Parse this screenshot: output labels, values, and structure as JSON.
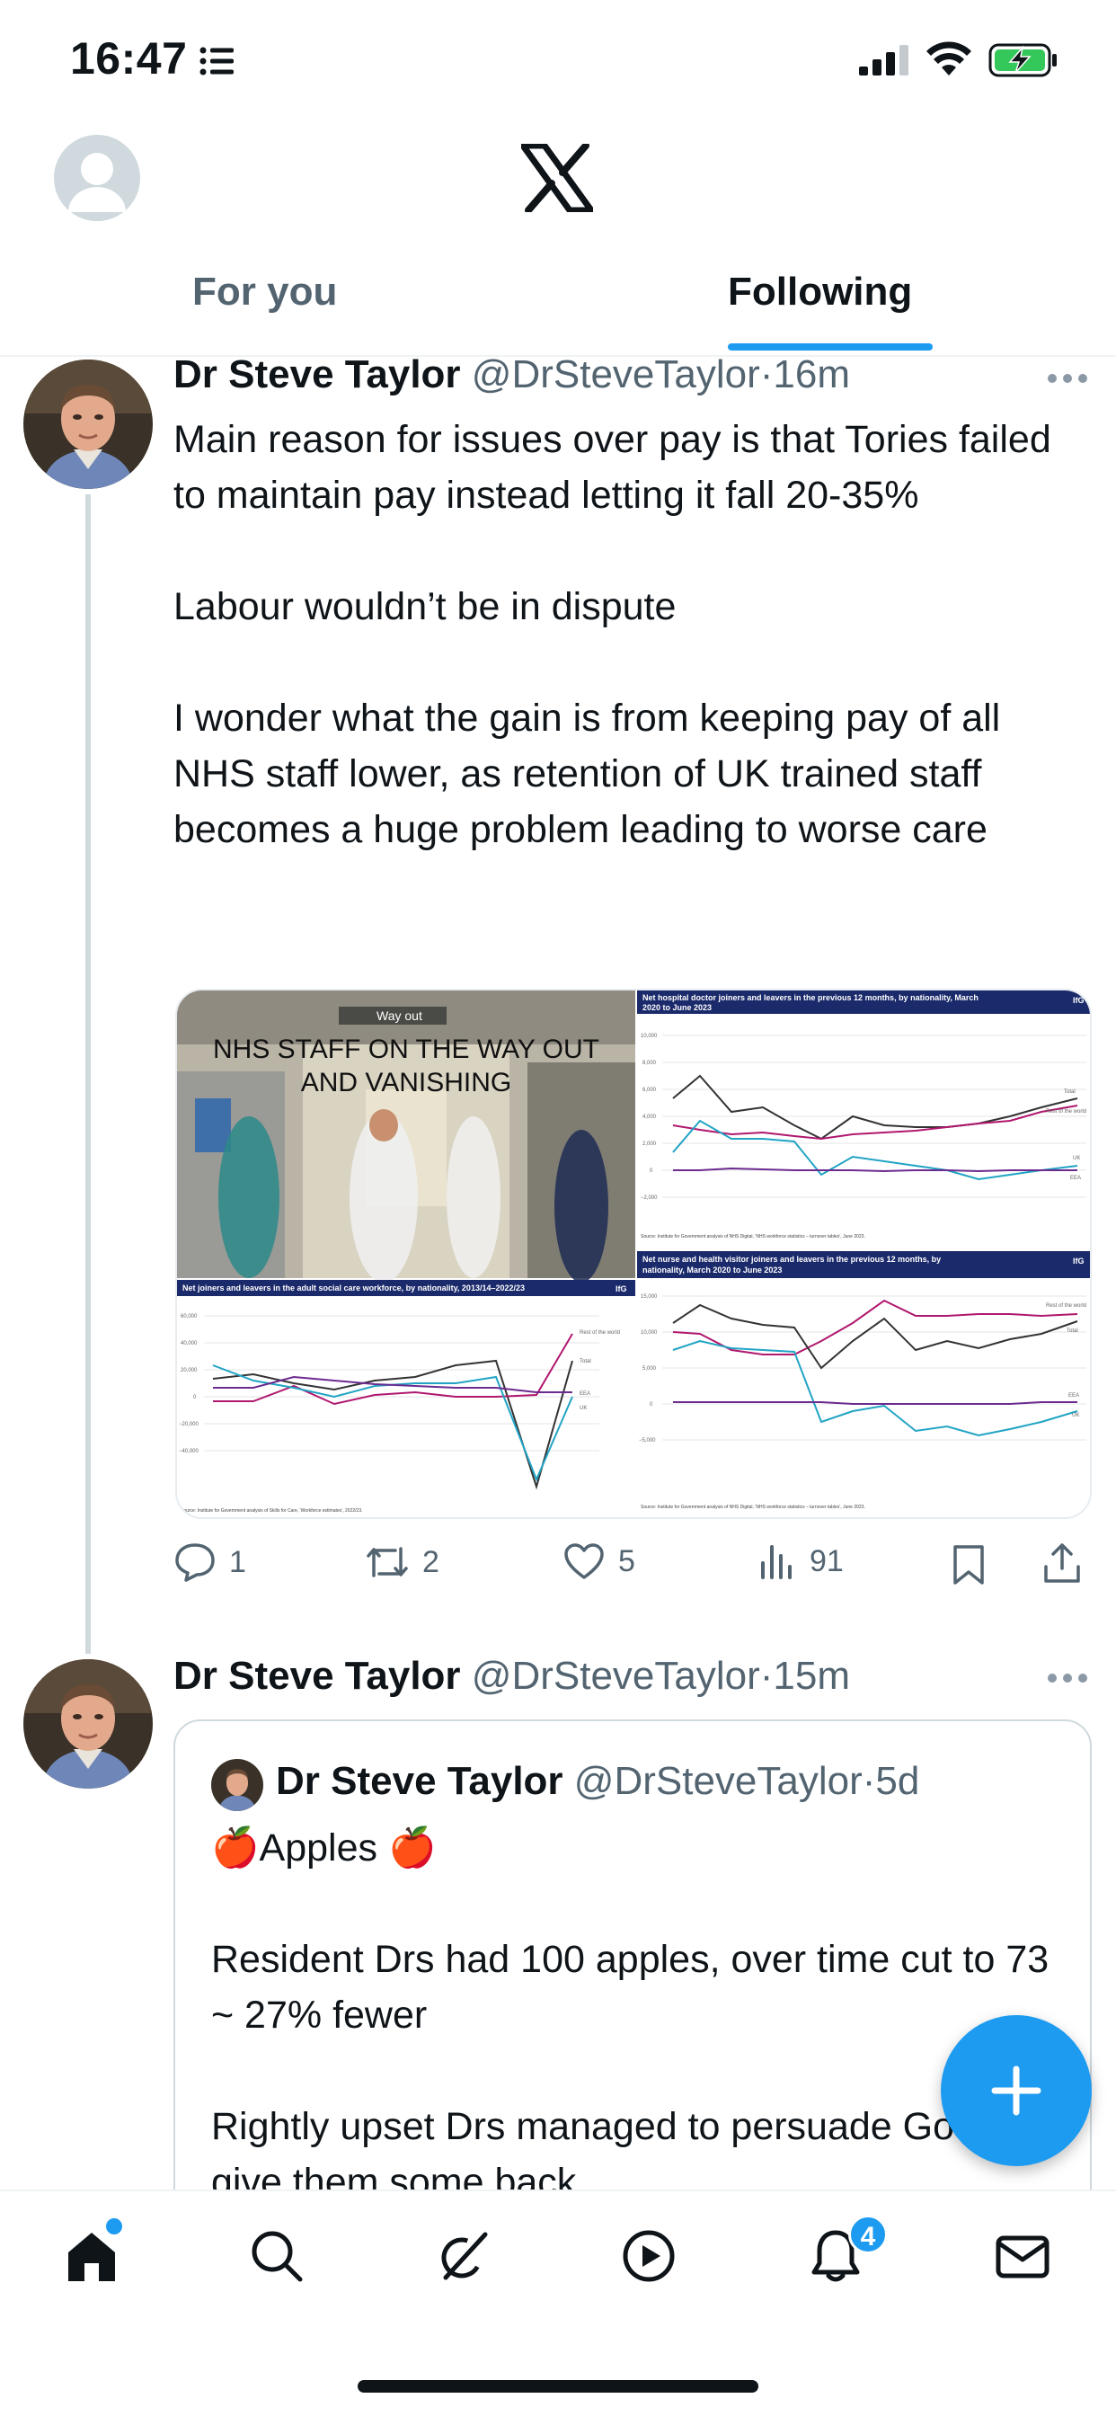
{
  "status": {
    "time": "16:47"
  },
  "nav": {
    "tab_for_you": "For you",
    "tab_following": "Following",
    "logo": "x-logo"
  },
  "tweet1": {
    "name": "Dr Steve Taylor",
    "handle": "@DrSteveTaylor",
    "sep": "·",
    "time": "16m",
    "paragraphs": [
      "Main reason for issues over pay is that Tories failed to maintain pay instead letting it fall 20-35%",
      "Labour wouldn’t be in dispute",
      "I wonder what the gain is from keeping pay of all NHS staff lower, as retention of UK trained staff becomes a huge problem leading to worse care"
    ],
    "media": {
      "photo_caption": "NHS STAFF ON THE WAY OUT AND VANISHING",
      "photo_sign": "Way out",
      "chart1_title": "Net hospital doctor joiners and leavers in the previous 12 months, by nationality, March 2020 to June 2023",
      "chart2_title": "Net joiners and leavers in the adult social care workforce, by nationality, 2013/14–2022/23",
      "chart3_title": "Net nurse and health visitor joiners and leavers in the previous 12 months, by nationality, March 2020 to June 2023",
      "ifg": "IfG"
    },
    "counts": {
      "replies": "1",
      "reposts": "2",
      "likes": "5",
      "views": "91"
    }
  },
  "tweet2": {
    "name": "Dr Steve Taylor",
    "handle": "@DrSteveTaylor",
    "sep": "·",
    "time": "15m",
    "quote": {
      "name": "Dr Steve Taylor",
      "handle": "@DrSteveTaylor",
      "sep": "·",
      "time": "5d",
      "title": "🍎Apples 🍎",
      "paragraphs": [
        "Resident Drs had 100 apples, over time cut to 73 ~ 27% fewer",
        "Rightly upset Drs managed to persuade Govt to give them some back"
      ]
    }
  },
  "bottom_nav": {
    "items": [
      "home-icon",
      "search-icon",
      "grok-icon",
      "video-icon",
      "notifications-icon",
      "messages-icon"
    ],
    "notif_badge": "4"
  },
  "colors": {
    "accent": "#1d9bf0",
    "text": "#0f1419",
    "muted": "#536471"
  }
}
